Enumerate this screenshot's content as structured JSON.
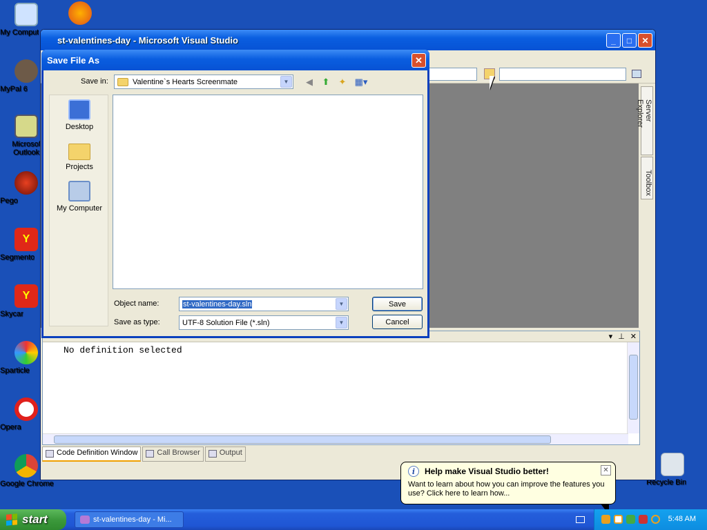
{
  "desktop": {
    "icons": [
      {
        "label": "My Comput"
      },
      {
        "label": ""
      },
      {
        "label": "MyPal 6"
      },
      {
        "label": "Microsof Outlook"
      },
      {
        "label": "Pego"
      },
      {
        "label": "Segmento"
      },
      {
        "label": "Skycar"
      },
      {
        "label": "Sparticle"
      },
      {
        "label": "Opera"
      },
      {
        "label": "Google Chrome"
      },
      {
        "label": "Recycle Bin"
      }
    ]
  },
  "vs_window": {
    "title": "st-valentines-day - Microsoft Visual Studio",
    "side_tabs": [
      "Server Explorer",
      "Toolbox"
    ],
    "code_definition": {
      "header": "Code Definition Window",
      "text": "No definition selected"
    },
    "bottom_tabs": [
      "Code Definition Window",
      "Call Browser",
      "Output"
    ]
  },
  "dialog": {
    "title": "Save File As",
    "save_in_label": "Save in:",
    "save_in_value": "Valentine`s Hearts Screenmate",
    "places": [
      "Desktop",
      "Projects",
      "My Computer"
    ],
    "object_name_label": "Object name:",
    "object_name_value": "st-valentines-day.sln",
    "save_as_type_label": "Save as type:",
    "save_as_type_value": "UTF-8 Solution File (*.sln)",
    "save_button": "Save",
    "cancel_button": "Cancel"
  },
  "balloon": {
    "title": "Help make Visual Studio better!",
    "body": "Want to learn about how you can improve the features you use? Click here to learn how..."
  },
  "taskbar": {
    "start_label": "start",
    "task_label": "st-valentines-day - Mi...",
    "clock": "5:48 AM"
  },
  "colors": {
    "desktop": "#1a50b8",
    "title_bar": "#0752d4",
    "start_green": "#3c9a3c",
    "balloon_bg": "#ffffe1"
  }
}
